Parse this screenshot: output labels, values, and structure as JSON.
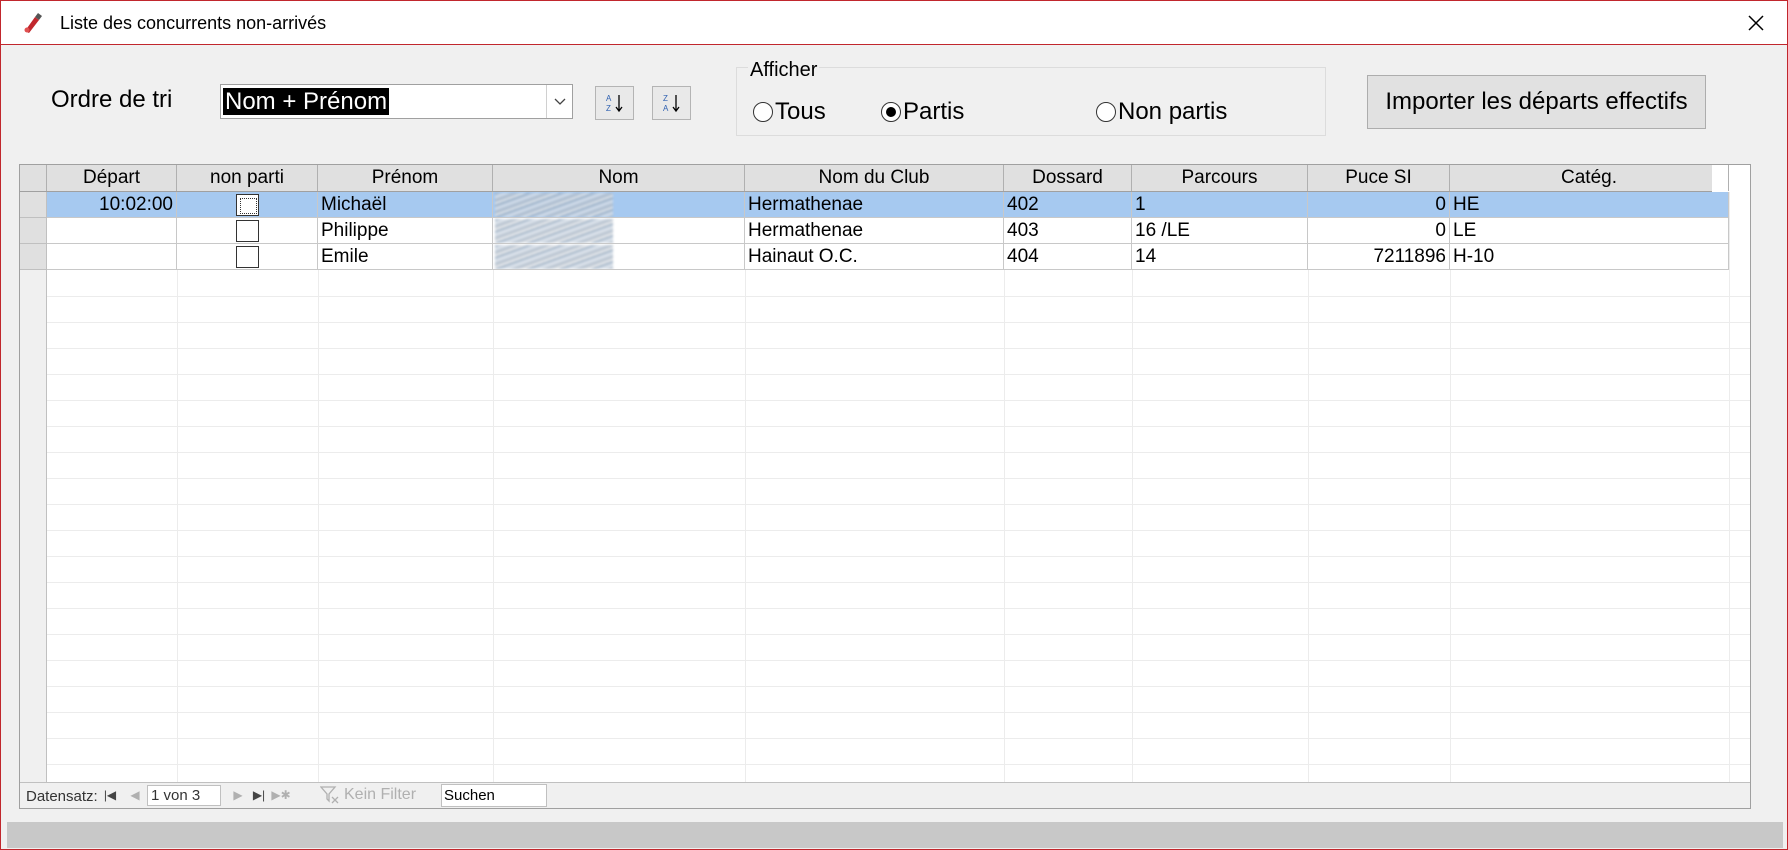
{
  "window": {
    "title": "Liste des concurrents non-arrivés"
  },
  "sort": {
    "label": "Ordre de tri",
    "selected": "Nom + Prénom"
  },
  "filter_group": {
    "legend": "Afficher",
    "options": [
      {
        "label": "Tous",
        "checked": false
      },
      {
        "label": "Partis",
        "checked": true
      },
      {
        "label": "Non partis",
        "checked": false
      }
    ]
  },
  "import_button": "Importer les départs effectifs",
  "grid": {
    "columns": [
      "Départ",
      "non parti",
      "Prénom",
      "Nom",
      "Nom du Club",
      "Dossard",
      "Parcours",
      "Puce SI",
      "Catég."
    ],
    "rows": [
      {
        "depart": "10:02:00",
        "non_parti": false,
        "prenom": "Michaël",
        "club": "Hermathenae",
        "dossard": "402",
        "parcours": "1",
        "puce": "0",
        "categ": "HE"
      },
      {
        "depart": "",
        "non_parti": false,
        "prenom": "Philippe",
        "club": "Hermathenae",
        "dossard": "403",
        "parcours": "16 /LE",
        "puce": "0",
        "categ": "LE"
      },
      {
        "depart": "",
        "non_parti": false,
        "prenom": "Emile",
        "club": "Hainaut O.C.",
        "dossard": "404",
        "parcours": "14",
        "puce": "7211896",
        "categ": "H-10"
      }
    ]
  },
  "navigator": {
    "label": "Datensatz:",
    "position": "1 von 3",
    "filter": "Kein Filter",
    "search": "Suchen"
  },
  "colors": {
    "accent": "#c1272d",
    "selected_row": "#a6c9f0"
  }
}
